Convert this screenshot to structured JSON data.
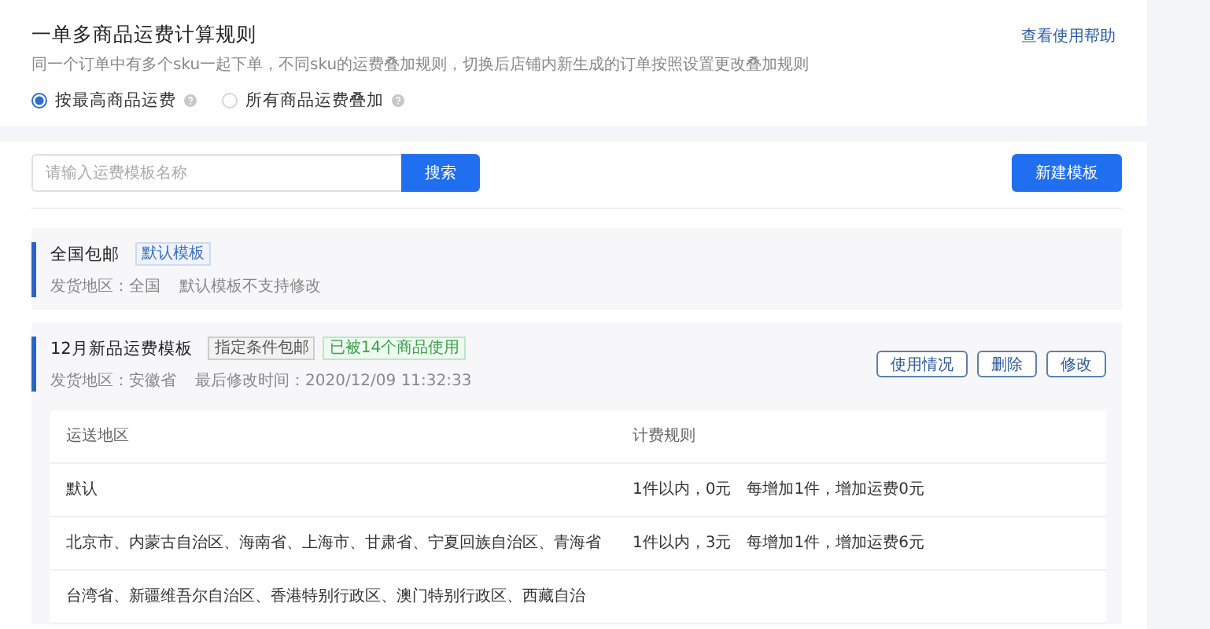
{
  "rule_card": {
    "title": "一单多商品运费计算规则",
    "help_link": "查看使用帮助",
    "description": "同一个订单中有多个sku一起下单，不同sku的运费叠加规则，切换后店铺内新生成的订单按照设置更改叠加规则",
    "options": [
      {
        "label": "按最高商品运费",
        "selected": true
      },
      {
        "label": "所有商品运费叠加",
        "selected": false
      }
    ]
  },
  "toolbar": {
    "search": {
      "placeholder": "请输入运费模板名称"
    },
    "search_button": "搜索",
    "create_button": "新建模板"
  },
  "templates": [
    {
      "name": "全国包邮",
      "tags": [
        {
          "kind": "default",
          "label": "默认模板"
        }
      ],
      "meta": [
        "发货地区：全国",
        "默认模板不支持修改"
      ]
    },
    {
      "name": "12月新品运费模板",
      "tags": [
        {
          "kind": "neutral",
          "label": "指定条件包邮"
        },
        {
          "kind": "success",
          "label": "已被14个商品使用"
        }
      ],
      "meta": [
        "发货地区：安徽省",
        "最后修改时间：2020/12/09 11:32:33"
      ],
      "actions": [
        "使用情况",
        "删除",
        "修改"
      ],
      "table": {
        "columns": [
          "运送地区",
          "计费规则"
        ],
        "rows": [
          [
            "默认",
            "1件以内，0元　每增加1件，增加运费0元"
          ],
          [
            "北京市、内蒙古自治区、海南省、上海市、甘肃省、宁夏回族自治区、青海省",
            "1件以内，3元　每增加1件，增加运费6元"
          ],
          [
            "台湾省、新疆维吾尔自治区、香港特别行政区、澳门特别行政区、西藏自治"
          ]
        ]
      }
    }
  ]
}
